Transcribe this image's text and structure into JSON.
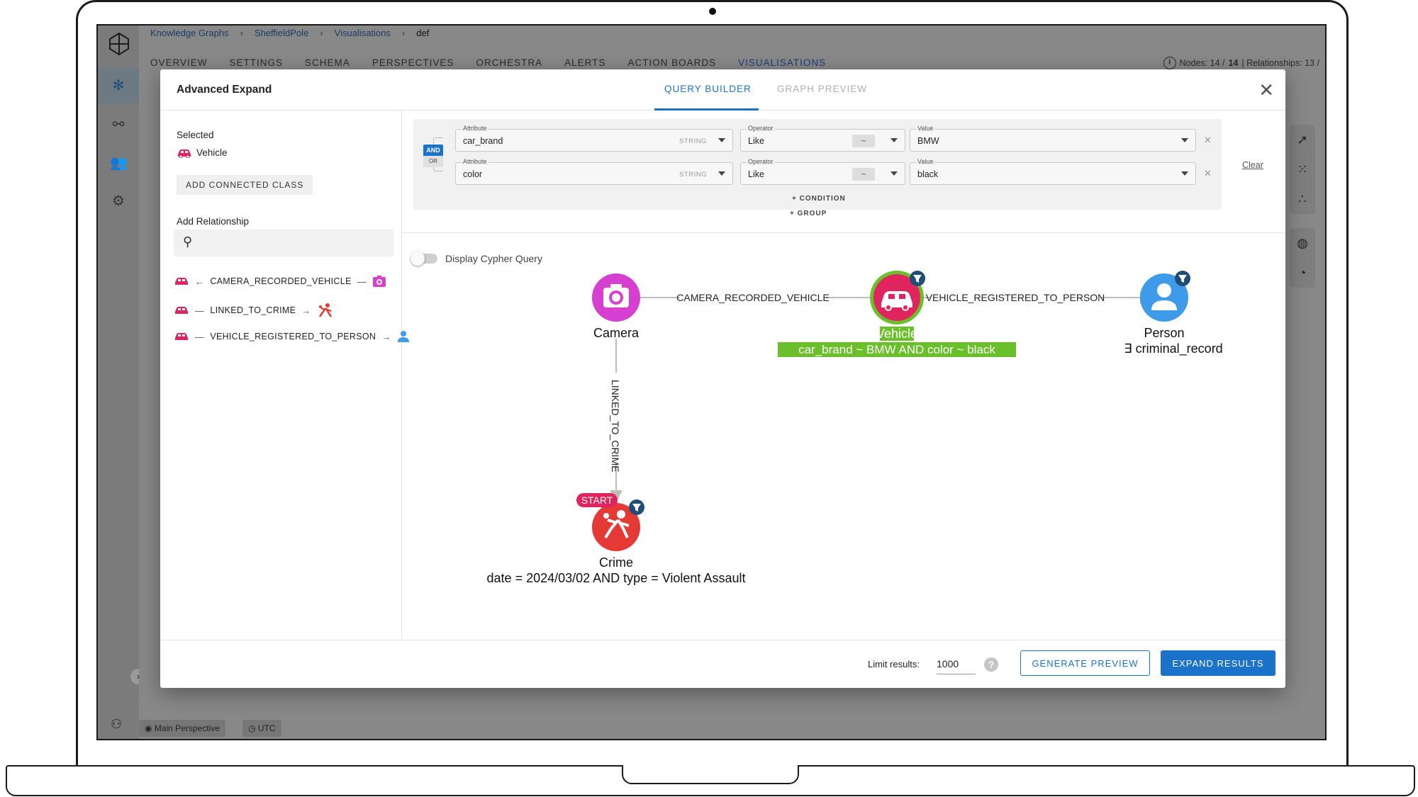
{
  "breadcrumb": [
    "Knowledge Graphs",
    "SheffieldPole",
    "Visualisations",
    "def"
  ],
  "nav_tabs": [
    "OVERVIEW",
    "SETTINGS",
    "SCHEMA",
    "PERSPECTIVES",
    "ORCHESTRA",
    "ALERTS",
    "ACTION BOARDS",
    "VISUALISATIONS"
  ],
  "active_nav_tab": "VISUALISATIONS",
  "stats": {
    "prefix": "Nodes: 14 / ",
    "bold": "14",
    "suffix": " | Relationships: 13 /"
  },
  "footer_chips": {
    "perspective": "Main Perspective",
    "timezone": "UTC"
  },
  "modal": {
    "title": "Advanced Expand",
    "tabs": [
      "QUERY BUILDER",
      "GRAPH PREVIEW"
    ],
    "active_tab": "QUERY BUILDER",
    "close_icon": "close-icon"
  },
  "left_panel": {
    "selected_label": "Selected",
    "selected_class": "Vehicle",
    "add_connected_class": "ADD CONNECTED CLASS",
    "add_relationship_label": "Add Relationship",
    "search_placeholder": "",
    "relationships": [
      {
        "direction": "←",
        "name": "CAMERA_RECORDED_VEHICLE",
        "end": "—",
        "target_icon": "camera-icon",
        "color": "#d63fcf"
      },
      {
        "direction": "—",
        "name": "LINKED_TO_CRIME",
        "end": "→",
        "target_icon": "crime-icon",
        "color": "#e53935"
      },
      {
        "direction": "—",
        "name": "VEHICLE_REGISTERED_TO_PERSON",
        "end": "→",
        "target_icon": "person-icon",
        "color": "#3d9be9"
      }
    ]
  },
  "query": {
    "operator_and": "AND",
    "operator_or": "OR",
    "conditions": [
      {
        "attribute_label": "Attribute",
        "attribute": "car_brand",
        "type": "STRING",
        "operator_label": "Operator",
        "operator": "Like",
        "symbol": "~",
        "value_label": "Value",
        "value": "BMW"
      },
      {
        "attribute_label": "Attribute",
        "attribute": "color",
        "type": "STRING",
        "operator_label": "Operator",
        "operator": "Like",
        "symbol": "~",
        "value_label": "Value",
        "value": "black"
      }
    ],
    "add_condition": "+ CONDITION",
    "add_group": "+ GROUP",
    "clear": "Clear"
  },
  "cypher_toggle": {
    "label": "Display Cypher Query",
    "on": false
  },
  "graph": {
    "nodes": {
      "camera": {
        "label": "Camera",
        "color": "#d63fcf"
      },
      "vehicle": {
        "label": "Vehicle",
        "filter": "car_brand ~ BMW AND color ~ black",
        "color": "#e0245e",
        "highlight": "#6abf2b"
      },
      "person": {
        "label": "Person",
        "filter": "∃ criminal_record",
        "color": "#3d9be9"
      },
      "crime": {
        "label": "Crime",
        "badge": "START",
        "filter": "date = 2024/03/02 AND type = Violent Assault",
        "color": "#e53935"
      }
    },
    "edges": [
      {
        "label": "CAMERA_RECORDED_VEHICLE"
      },
      {
        "label": "VEHICLE_REGISTERED_TO_PERSON"
      },
      {
        "label": "LINKED_TO_CRIME"
      }
    ]
  },
  "footer": {
    "limit_label": "Limit results:",
    "limit_value": "1000",
    "help": "?",
    "generate_preview": "GENERATE PREVIEW",
    "expand_results": "EXPAND RESULTS"
  }
}
